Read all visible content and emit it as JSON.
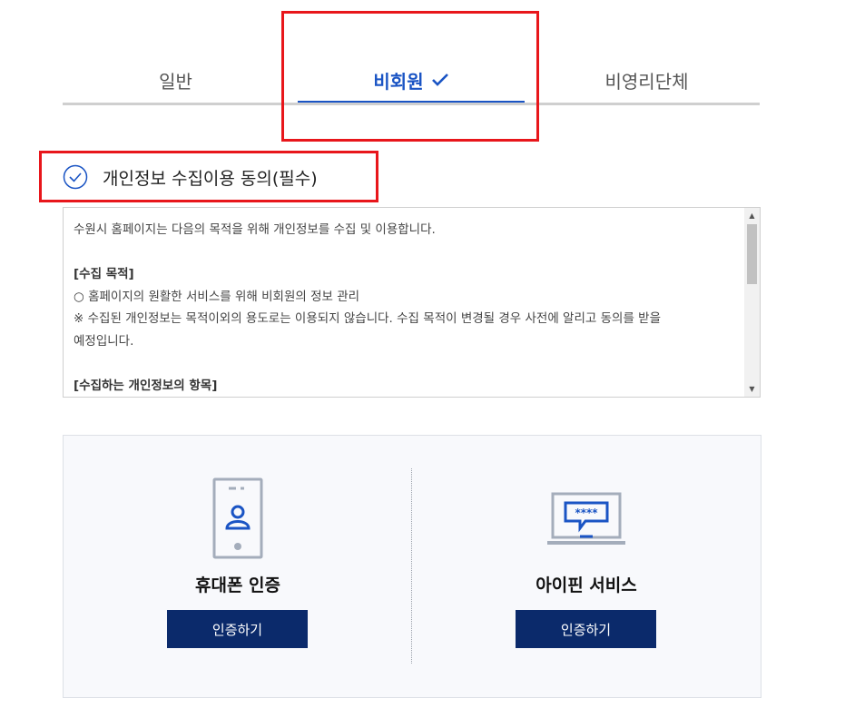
{
  "tabs": [
    {
      "label": "일반",
      "selected": false
    },
    {
      "label": "비회원",
      "selected": true
    },
    {
      "label": "비영리단체",
      "selected": false
    }
  ],
  "consent": {
    "title": "개인정보 수집이용 동의(필수)",
    "intro": "수원시 홈페이지는 다음의 목적을 위해 개인정보를 수집 및 이용합니다.",
    "purpose_heading": "[수집 목적]",
    "purpose_item": "○ 홈페이지의 원활한 서비스를 위해 비회원의 정보 관리",
    "notice_line1": "※ 수집된 개인정보는 목적이외의 용도로는 이용되지 않습니다. 수집 목적이 변경될 경우 사전에 알리고 동의를 받을",
    "notice_line2": "예정입니다.",
    "items_heading": "[수집하는 개인정보의 항목]"
  },
  "auth": {
    "phone": {
      "title": "휴대폰 인증",
      "button": "인증하기",
      "icon": "mobile-phone-person-icon"
    },
    "ipin": {
      "title": "아이핀 서비스",
      "button": "인증하기",
      "icon": "laptop-password-icon"
    }
  },
  "colors": {
    "accent": "#1a54c4",
    "button_bg": "#0b2a6b",
    "highlight_box": "#e8161b"
  }
}
